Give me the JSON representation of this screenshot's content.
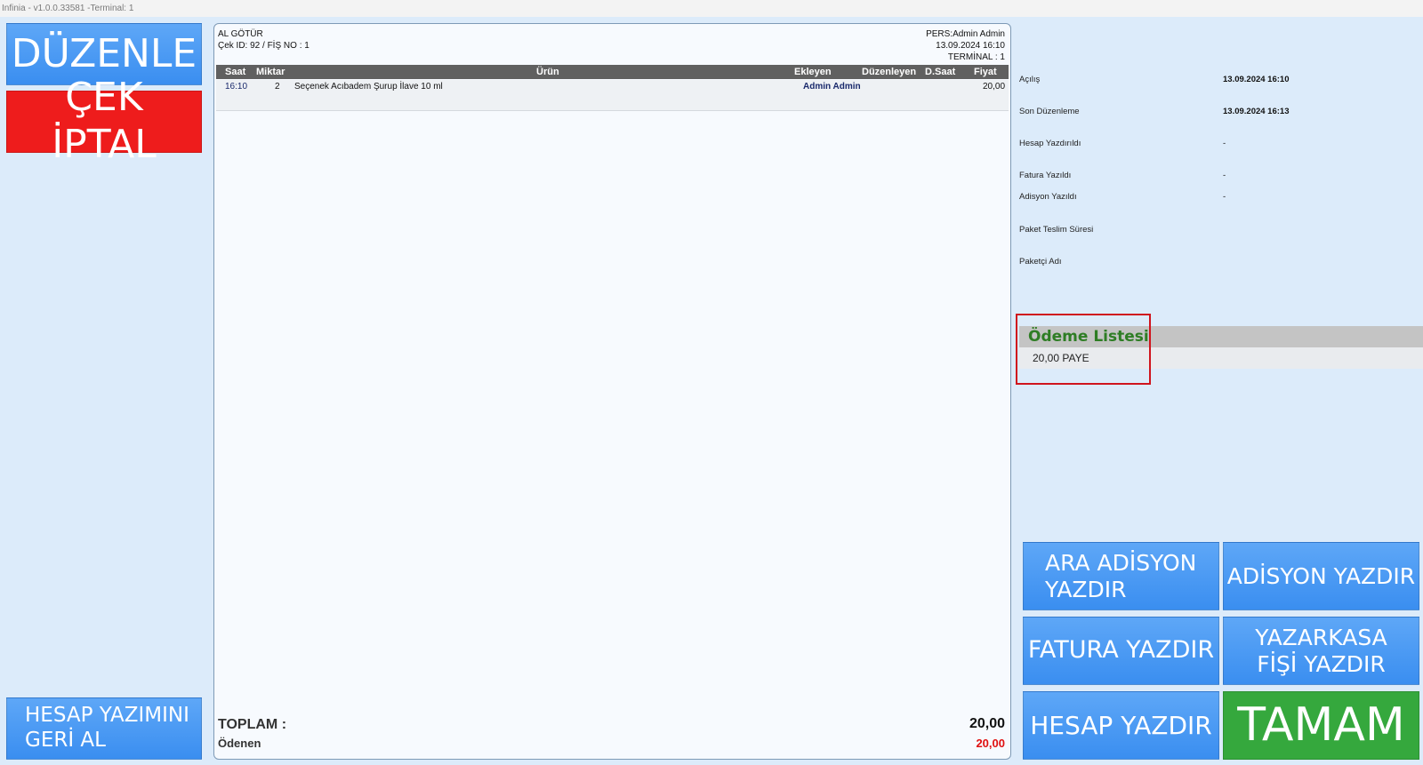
{
  "window": {
    "title": "Infinia - v1.0.0.33581 -Terminal: 1"
  },
  "left_buttons": {
    "duzenle": "DÜZENLE",
    "cek_iptal": "ÇEK İPTAL",
    "hesap_geri_line1": "HESAP YAZIMINI",
    "hesap_geri_line2": "GERİ AL"
  },
  "receipt": {
    "type": "AL GÖTÜR",
    "check_info": "Çek ID: 92 / FİŞ NO : 1",
    "personnel": "PERS:Admin Admin",
    "datetime": "13.09.2024 16:10",
    "terminal": "TERMİNAL : 1",
    "columns": {
      "saat": "Saat",
      "miktar": "Miktar",
      "urun": "Ürün",
      "ekleyen": "Ekleyen",
      "duzenleyen": "Düzenleyen",
      "dsaat": "D.Saat",
      "fiyat": "Fiyat"
    },
    "rows": [
      {
        "saat": "16:10",
        "miktar": "2",
        "urun": "Seçenek Acıbadem Şurup İlave 10 ml",
        "ekleyen": "Admin Admin",
        "duzenleyen": "",
        "dsaat": "",
        "fiyat": "20,00"
      }
    ],
    "total_label": "TOPLAM :",
    "total_value": "20,00",
    "paid_label": "Ödenen",
    "paid_value": "20,00"
  },
  "info": [
    {
      "label": "Açılış",
      "value": "13.09.2024 16:10"
    },
    {
      "label": "Son Düzenleme",
      "value": "13.09.2024 16:13"
    },
    {
      "label": "Hesap Yazdırıldı",
      "value": "-"
    },
    {
      "label": "Fatura Yazıldı",
      "value": "-"
    },
    {
      "label": "Adisyon Yazıldı",
      "value": "-"
    },
    {
      "label": "Paket Teslim Süresi",
      "value": ""
    },
    {
      "label": "Paketçi Adı",
      "value": ""
    }
  ],
  "payment": {
    "title": "Ödeme Listesi",
    "items": [
      "20,00 PAYE"
    ]
  },
  "action_buttons": {
    "ara_line1": "ARA ADİSYON",
    "ara_line2": "YAZDIR",
    "adisyon": "ADİSYON YAZDIR",
    "fatura": "FATURA YAZDIR",
    "yazarkasa_line1": "YAZARKASA",
    "yazarkasa_line2": "FİŞİ YAZDIR",
    "hesap": "HESAP YAZDIR",
    "tamam": "TAMAM"
  },
  "colors": {
    "background": "#dcebfa",
    "button_blue": "#4a9af3",
    "button_red": "#ee1c1c",
    "button_green": "#35a83d",
    "payment_title": "#2e7d24",
    "paid_value": "#e01010",
    "highlight_box": "#d0141d"
  }
}
